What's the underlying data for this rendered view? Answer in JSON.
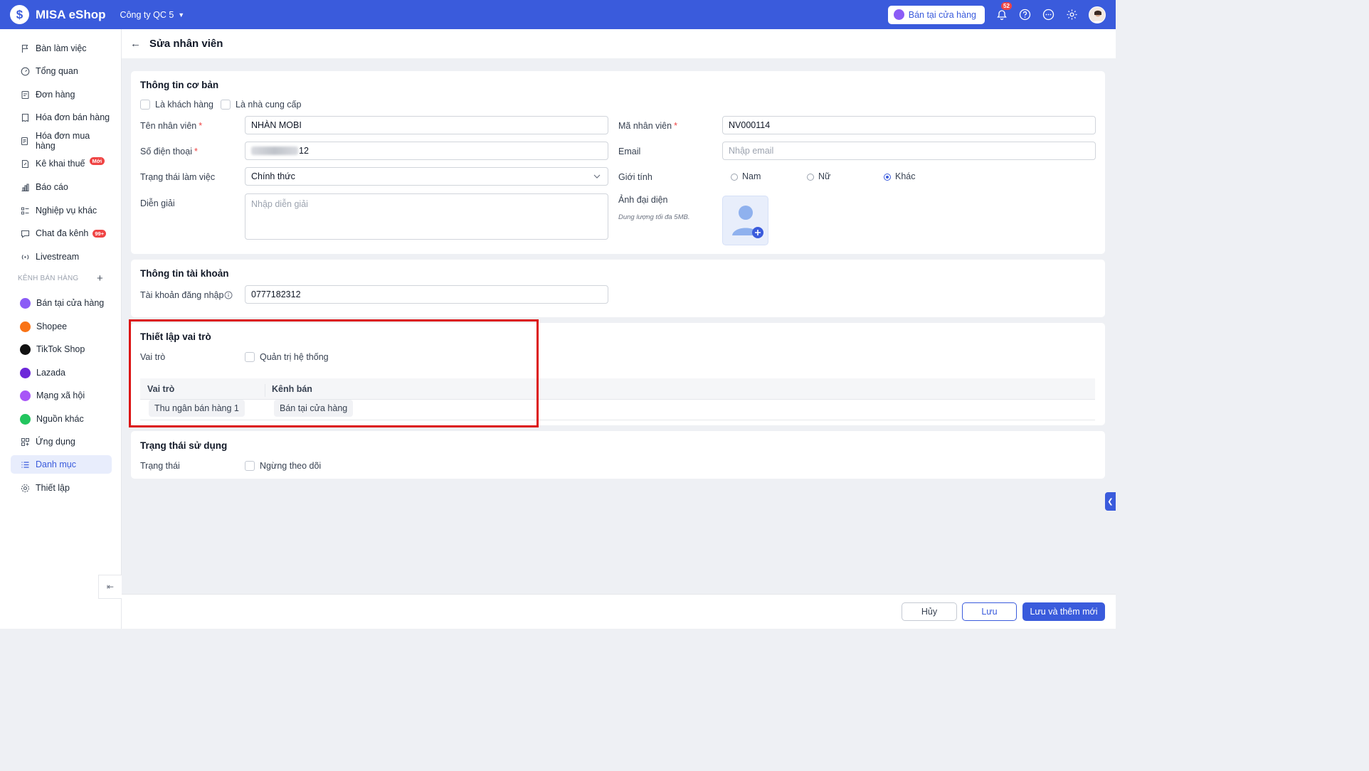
{
  "app": {
    "name": "MISA eShop",
    "company": "Công ty QC 5"
  },
  "topbar": {
    "store_button": "Bán tại cửa hàng",
    "notification_count": "52"
  },
  "sidebar": {
    "items": [
      {
        "label": "Bàn làm việc",
        "icon": "flag-icon"
      },
      {
        "label": "Tổng quan",
        "icon": "gauge-icon"
      },
      {
        "label": "Đơn hàng",
        "icon": "order-icon"
      },
      {
        "label": "Hóa đơn bán hàng",
        "icon": "invoice-icon"
      },
      {
        "label": "Hóa đơn mua hàng",
        "icon": "purchase-invoice-icon"
      },
      {
        "label": "Kê khai thuế",
        "icon": "tax-icon",
        "badge": "Mới"
      },
      {
        "label": "Báo cáo",
        "icon": "chart-icon"
      },
      {
        "label": "Nghiệp vụ khác",
        "icon": "list-icon"
      },
      {
        "label": "Chat đa kênh",
        "icon": "chat-icon",
        "badge": "99+"
      },
      {
        "label": "Livestream",
        "icon": "broadcast-icon"
      }
    ],
    "section_label": "KÊNH BÁN HÀNG",
    "channels": [
      {
        "label": "Bán tại cửa hàng",
        "color": "#8b5cf6"
      },
      {
        "label": "Shopee",
        "color": "#f97316"
      },
      {
        "label": "TikTok Shop",
        "color": "#111111"
      },
      {
        "label": "Lazada",
        "color": "#6d28d9"
      },
      {
        "label": "Mạng xã hội",
        "color": "#a855f7"
      },
      {
        "label": "Nguồn khác",
        "color": "#22c55e"
      }
    ],
    "bottom_items": [
      {
        "label": "Ứng dụng",
        "icon": "apps-icon"
      },
      {
        "label": "Danh mục",
        "icon": "category-list-icon",
        "active": true
      },
      {
        "label": "Thiết lập",
        "icon": "settings-icon"
      }
    ]
  },
  "page": {
    "title": "Sửa nhân viên"
  },
  "basic_info": {
    "title": "Thông tin cơ bản",
    "is_customer_label": "Là khách hàng",
    "is_supplier_label": "Là nhà cung cấp",
    "name_label": "Tên nhân viên",
    "name_value": "NHÀN MOBI",
    "phone_label": "Số điện thoại",
    "phone_value_visible": "12",
    "status_label": "Trạng thái làm việc",
    "status_value": "Chính thức",
    "desc_label": "Diễn giải",
    "desc_placeholder": "Nhập diễn giải",
    "code_label": "Mã nhân viên",
    "code_value": "NV000114",
    "email_label": "Email",
    "email_placeholder": "Nhập email",
    "gender_label": "Giới tính",
    "gender_options": [
      "Nam",
      "Nữ",
      "Khác"
    ],
    "gender_selected": "Khác",
    "avatar_label": "Ảnh đại diện",
    "avatar_hint": "Dung lượng tối đa 5MB."
  },
  "account_info": {
    "title": "Thông tin tài khoản",
    "login_label": "Tài khoản đăng nhập",
    "login_value": "0777182312"
  },
  "role_setup": {
    "title": "Thiết lập vai trò",
    "role_label": "Vai trò",
    "admin_label": "Quản trị hệ thống",
    "table_headers": [
      "Vai trò",
      "Kênh bán"
    ],
    "rows": [
      {
        "role": "Thu ngân bán hàng 1",
        "channel": "Bán tại cửa hàng"
      }
    ]
  },
  "usage_status": {
    "title": "Trạng thái sử dụng",
    "status_label": "Trạng thái",
    "stop_label": "Ngừng theo dõi"
  },
  "footer": {
    "cancel": "Hủy",
    "save": "Lưu",
    "save_new": "Lưu và thêm mới"
  }
}
